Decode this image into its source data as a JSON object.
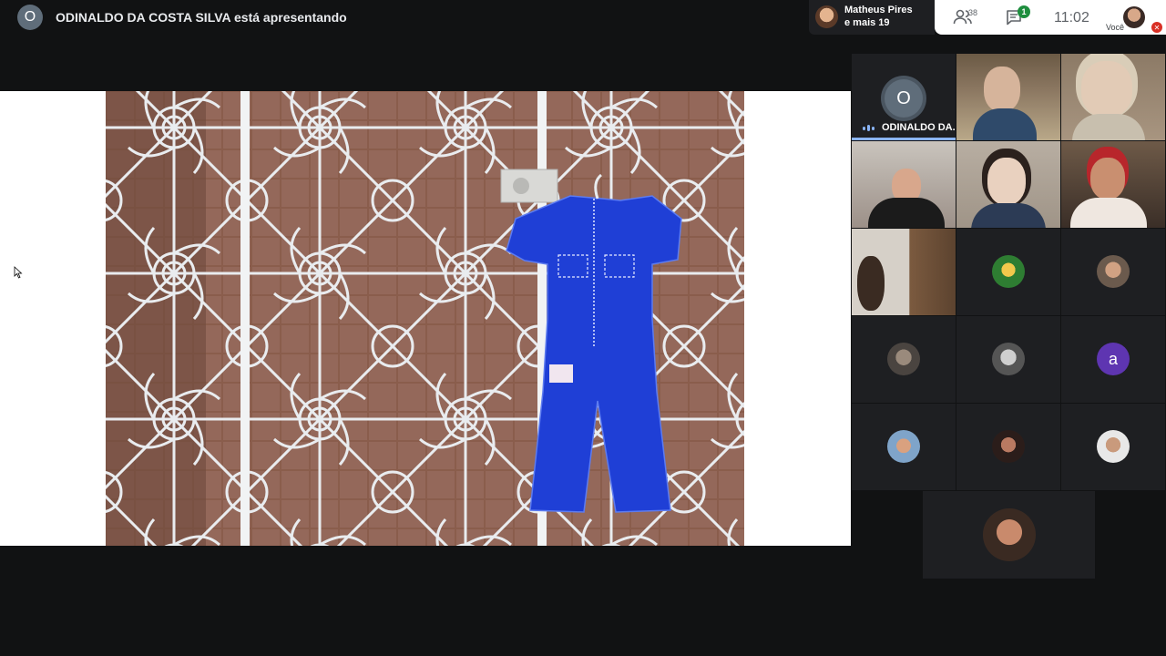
{
  "presenter": {
    "initial": "O",
    "text": "ODINALDO DA COSTA SILVA está apresentando"
  },
  "join_notice": {
    "line1": "Matheus Pires",
    "line2": "e mais 19"
  },
  "info": {
    "people_count": "38",
    "chat_badge": "1",
    "time": "11:02",
    "self_label": "Você"
  },
  "participants": {
    "presenter_tile": {
      "initial": "O",
      "name": "ODINALDO DA..."
    },
    "letter_tile": {
      "initial": "a"
    }
  },
  "icons": {
    "people": "people-icon",
    "chat": "chat-icon",
    "mic_off": "mic-off-icon",
    "cursor": "cursor-icon"
  },
  "colors": {
    "background": "#111213",
    "accent_blue": "#8ab4f8",
    "badge_green": "#1e8e3e",
    "mic_red": "#d93025",
    "letter_purple": "#5e35b1"
  }
}
